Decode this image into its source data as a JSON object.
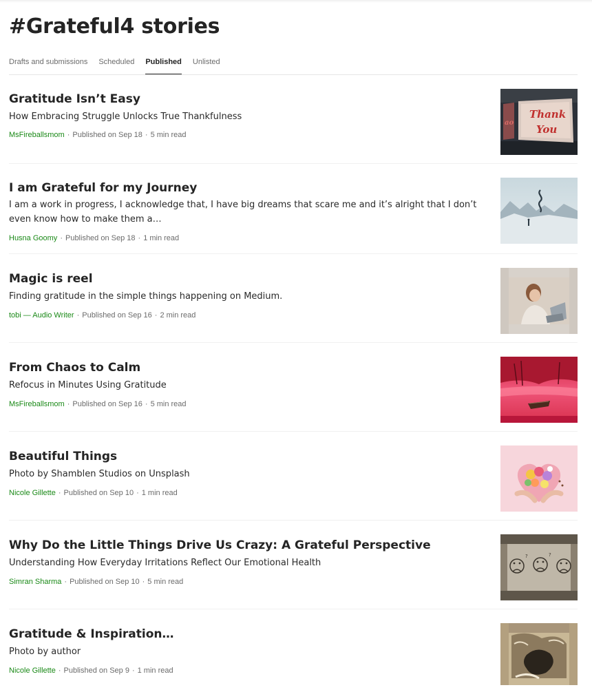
{
  "page": {
    "title": "#Grateful4 stories"
  },
  "tabs": [
    {
      "label": "Drafts and submissions",
      "active": false
    },
    {
      "label": "Scheduled",
      "active": false
    },
    {
      "label": "Published",
      "active": true
    },
    {
      "label": "Unlisted",
      "active": false
    }
  ],
  "stories": [
    {
      "title": "Gratitude Isn’t Easy",
      "subtitle": "How Embracing Struggle Unlocks True Thankfulness",
      "author": "MsFireballsmom",
      "published": "Published on Sep 18",
      "read_time": "5 min read",
      "thumbnail": "thank-you-sign-image"
    },
    {
      "title": "I am Grateful for my Journey",
      "subtitle": "I am a work in progress, I acknowledge that, I have big dreams that scare me and it’s alright that I don’t even know how to make them a…",
      "author": "Husna Goomy",
      "published": "Published on Sep 18",
      "read_time": "1 min read",
      "thumbnail": "misty-mountain-figure-image"
    },
    {
      "title": "Magic is reel",
      "subtitle": "Finding gratitude in the simple things happening on Medium.",
      "author": "tobi — Audio Writer",
      "published": "Published on Sep 16",
      "read_time": "2 min read",
      "thumbnail": "woman-at-laptop-image"
    },
    {
      "title": "From Chaos to Calm",
      "subtitle": "Refocus in Minutes Using Gratitude",
      "author": "MsFireballsmom",
      "published": "Published on Sep 16",
      "read_time": "5 min read",
      "thumbnail": "red-lake-boat-image"
    },
    {
      "title": "Beautiful Things",
      "subtitle": "Photo by Shamblen Studios on Unsplash",
      "author": "Nicole Gillette",
      "published": "Published on Sep 10",
      "read_time": "1 min read",
      "thumbnail": "flower-heart-hands-image"
    },
    {
      "title": "Why Do the Little Things Drive Us Crazy: A Grateful Perspective",
      "subtitle": "Understanding How Everyday Irritations Reflect Our Emotional Health",
      "author": "Simran Sharma",
      "published": "Published on Sep 10",
      "read_time": "5 min read",
      "thumbnail": "frowning-faces-image"
    },
    {
      "title": "Gratitude & Inspiration…",
      "subtitle": "Photo by author",
      "author": "Nicole Gillette",
      "published": "Published on Sep 9",
      "read_time": "1 min read",
      "thumbnail": "dark-texture-image"
    }
  ],
  "separator": "·",
  "colors": {
    "author": "#1a8917",
    "meta": "#6b6b6b",
    "title": "#242424"
  }
}
